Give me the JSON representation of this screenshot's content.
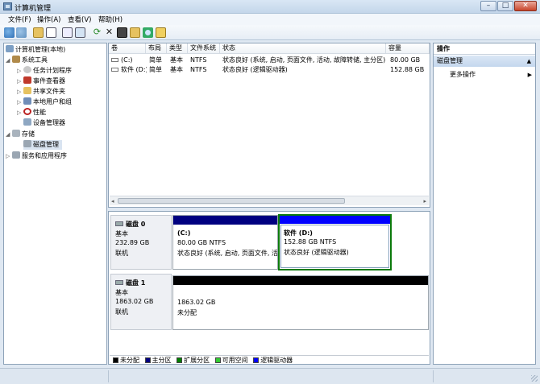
{
  "window": {
    "title": "计算机管理",
    "minimize": "–",
    "maximize": "□",
    "close": "✕"
  },
  "menu": [
    "文件(F)",
    "操作(A)",
    "查看(V)",
    "帮助(H)"
  ],
  "toolbar": [
    "back-icon",
    "forward-icon",
    "up-folder-icon",
    "show-tree-icon",
    "properties-icon",
    "help-icon",
    "refresh-icon",
    "delete-icon",
    "properties-sheet-icon",
    "open-icon",
    "search-icon",
    "wizard-icon"
  ],
  "tree": {
    "root": "计算机管理(本地)",
    "system_tools": "系统工具",
    "task_scheduler": "任务计划程序",
    "event_viewer": "事件查看器",
    "shared_folders": "共享文件夹",
    "local_users": "本地用户和组",
    "performance": "性能",
    "device_manager": "设备管理器",
    "storage": "存储",
    "disk_management": "磁盘管理",
    "services": "服务和应用程序"
  },
  "volumes": {
    "headers": [
      "卷",
      "布局",
      "类型",
      "文件系统",
      "状态",
      "容量"
    ],
    "rows": [
      {
        "volume": "(C:)",
        "layout": "简单",
        "type": "基本",
        "fs": "NTFS",
        "status": "状态良好 (系统, 启动, 页面文件, 活动, 故障转储, 主分区)",
        "capacity": "80.00 GB"
      },
      {
        "volume": "软件 (D:)",
        "layout": "简单",
        "type": "基本",
        "fs": "NTFS",
        "status": "状态良好 (逻辑驱动器)",
        "capacity": "152.88 GB"
      }
    ]
  },
  "disks": [
    {
      "name": "磁盘 0",
      "type": "基本",
      "size": "232.89 GB",
      "state": "联机",
      "partitions": [
        {
          "title": "(C:)",
          "size": "80.00 GB NTFS",
          "status": "状态良好 (系统, 启动, 页面文件, 活"
        },
        {
          "title": "软件  (D:)",
          "size": "152.88 GB NTFS",
          "status": "状态良好 (逻辑驱动器)"
        }
      ]
    },
    {
      "name": "磁盘 1",
      "type": "基本",
      "size": "1863.02 GB",
      "state": "联机",
      "partitions": [
        {
          "size": "1863.02 GB",
          "status": "未分配"
        }
      ]
    }
  ],
  "legend": [
    {
      "label": "未分配",
      "color": "#000000"
    },
    {
      "label": "主分区",
      "color": "#000080"
    },
    {
      "label": "扩展分区",
      "color": "#008000"
    },
    {
      "label": "可用空间",
      "color": "#33cc33"
    },
    {
      "label": "逻辑驱动器",
      "color": "#0000ff"
    }
  ],
  "actions": {
    "header": "操作",
    "section": "磁盘管理",
    "more": "更多操作"
  },
  "colors": {
    "primary": "#000080",
    "logical": "#0000ff",
    "extended": "#008000",
    "unallocated": "#000000",
    "selected_header": "#c8d9ee"
  }
}
